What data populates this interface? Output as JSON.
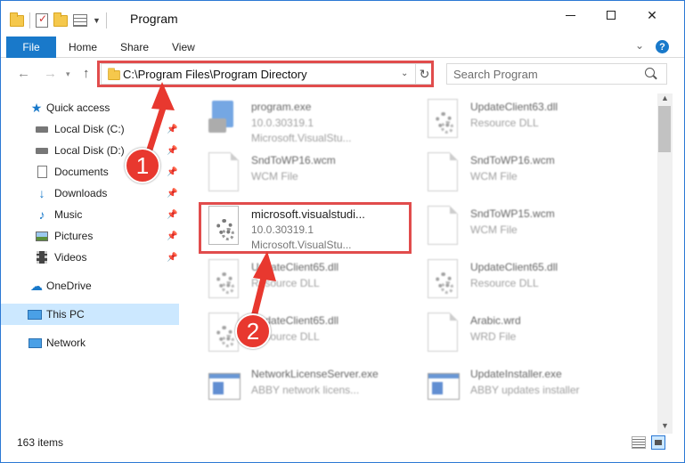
{
  "window": {
    "title": "Program",
    "controls": {
      "minimize": "",
      "maximize": "",
      "close": "✕"
    }
  },
  "ribbon": {
    "tabs": [
      "File",
      "Home",
      "Share",
      "View"
    ]
  },
  "nav": {
    "back": "←",
    "forward": "→",
    "up": "↑",
    "address": "C:\\Program Files\\Program Directory",
    "search_placeholder": "Search Program"
  },
  "sidebar": {
    "items": [
      {
        "label": "Quick access",
        "icon": "star-icon",
        "pinned": false
      },
      {
        "label": "Local Disk (C:)",
        "icon": "drive-icon",
        "pinned": true
      },
      {
        "label": "Local Disk (D:)",
        "icon": "drive-icon",
        "pinned": true
      },
      {
        "label": "Documents",
        "icon": "documents-icon",
        "pinned": true
      },
      {
        "label": "Downloads",
        "icon": "downloads-icon",
        "pinned": true
      },
      {
        "label": "Music",
        "icon": "music-icon",
        "pinned": true
      },
      {
        "label": "Pictures",
        "icon": "pictures-icon",
        "pinned": true
      },
      {
        "label": "Videos",
        "icon": "videos-icon",
        "pinned": true
      },
      {
        "label": "OneDrive",
        "icon": "onedrive-icon",
        "pinned": false
      },
      {
        "label": "This PC",
        "icon": "pc-icon",
        "pinned": false,
        "selected": true
      },
      {
        "label": "Network",
        "icon": "network-icon",
        "pinned": false
      }
    ]
  },
  "files": [
    {
      "name": "program.exe",
      "line2": "10.0.30319.1",
      "line3": "Microsoft.VisualStu...",
      "icon": "program-icon"
    },
    {
      "name": "UpdateClient63.dll",
      "line2": "Resource DLL",
      "line3": "",
      "icon": "dll-icon"
    },
    {
      "name": "SndToWP16.wcm",
      "line2": "WCM File",
      "line3": "",
      "icon": "file-icon"
    },
    {
      "name": "SndToWP16.wcm",
      "line2": "WCM File",
      "line3": "",
      "icon": "file-icon"
    },
    {
      "name": "microsoft.visualstudi...",
      "line2": "10.0.30319.1",
      "line3": "Microsoft.VisualStu...",
      "icon": "dll-icon"
    },
    {
      "name": "SndToWP15.wcm",
      "line2": "WCM File",
      "line3": "",
      "icon": "file-icon"
    },
    {
      "name": "UpdateClient65.dll",
      "line2": "Resource DLL",
      "line3": "",
      "icon": "dll-icon"
    },
    {
      "name": "UpdateClient65.dll",
      "line2": "Resource DLL",
      "line3": "",
      "icon": "dll-icon"
    },
    {
      "name": "UpdateClient65.dll",
      "line2": "Resource DLL",
      "line3": "",
      "icon": "dll-icon"
    },
    {
      "name": "Arabic.wrd",
      "line2": "WRD File",
      "line3": "",
      "icon": "file-icon"
    },
    {
      "name": "NetworkLicenseServer.exe",
      "line2": "ABBY network licens...",
      "line3": "",
      "icon": "exe-icon"
    },
    {
      "name": "UpdateInstaller.exe",
      "line2": "ABBY updates installer",
      "line3": "",
      "icon": "exe-icon"
    }
  ],
  "status": {
    "count": "163 items"
  },
  "annotations": {
    "step1": "1",
    "step2": "2",
    "color": "#e8382f"
  }
}
